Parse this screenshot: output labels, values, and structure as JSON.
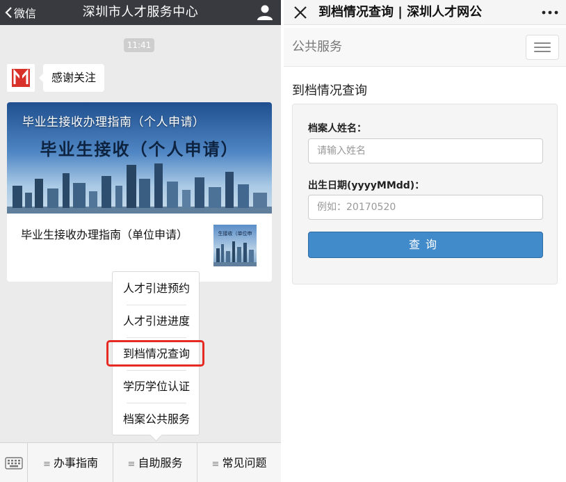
{
  "left_header": {
    "back_label": "微信",
    "title": "深圳市人才服务中心"
  },
  "chat": {
    "time": "11:41",
    "greeting": "感谢关注"
  },
  "news_card": {
    "banner_title": "毕业生接收办理指南（个人申请）",
    "banner_subtitle": "毕业生接收（个人申请）",
    "item2_title": "毕业生接收办理指南（单位申请）",
    "thumb_text": "生接收（单位申"
  },
  "popup_menu": {
    "items": [
      "人才引进预约",
      "人才引进进度",
      "到档情况查询",
      "学历学位认证",
      "档案公共服务"
    ],
    "highlighted": "到档情况查询",
    "highlight_color": "#e52a24"
  },
  "bottom_menu": {
    "tabs": [
      "办事指南",
      "自助服务",
      "常见问题"
    ]
  },
  "right_header": {
    "title": "到档情况查询 | 深圳人才网公"
  },
  "site_nav": {
    "brand": "公共服务"
  },
  "form": {
    "heading": "到档情况查询",
    "name_label": "档案人姓名：",
    "name_placeholder": "请输入姓名",
    "dob_label": "出生日期(yyyyMMdd)：",
    "dob_placeholder": "例如：20170520",
    "submit_label": "查询"
  },
  "colors": {
    "wechat_bar": "#393a3f",
    "chat_background": "#ebebeb",
    "primary_button": "#428bca"
  },
  "icons": [
    "chevron-left-icon",
    "person-icon",
    "keyboard-icon",
    "menu-lines-icon",
    "close-icon",
    "more-icon",
    "hamburger-icon",
    "logo-icon"
  ]
}
